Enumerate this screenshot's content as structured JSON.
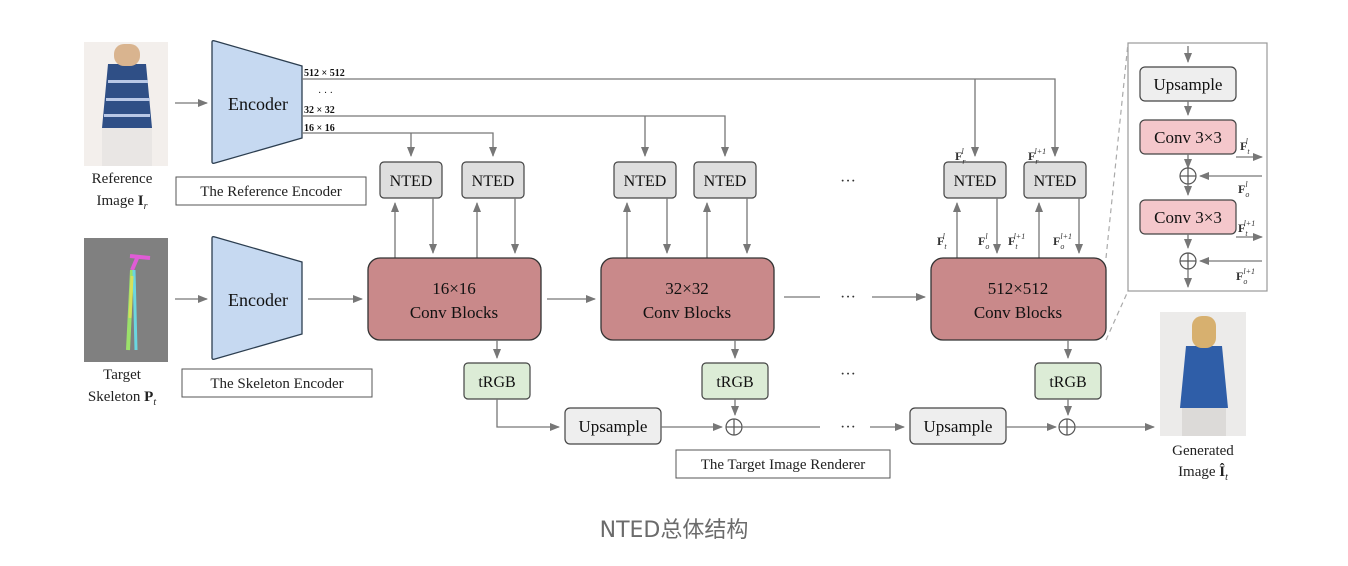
{
  "labels": {
    "encoder": "Encoder",
    "nted": "NTED",
    "trgb": "tRGB",
    "upsample": "Upsample",
    "conv33": "Conv 3×3",
    "dots": "···",
    "conv_line2": "Conv Blocks",
    "res_16": "16×16",
    "res_32": "32×32",
    "res_512": "512×512",
    "feat_512": "512 × 512",
    "feat_32": "32 × 32",
    "feat_16": "16 × 16",
    "feat_dots": "· · ·"
  },
  "captions": {
    "reference_encoder": "The Reference Encoder",
    "skeleton_encoder": "The Skeleton Encoder",
    "renderer": "The Target Image Renderer",
    "ref_line1": "Reference",
    "ref_line2": "Image",
    "tgt_line1": "Target",
    "tgt_line2": "Skeleton",
    "gen_line1": "Generated",
    "gen_line2": "Image",
    "figure": "NTED总体结构"
  },
  "math": {
    "ref_symbol": "I",
    "ref_sub": "r",
    "tgt_symbol": "P",
    "tgt_sub": "t",
    "gen_symbol": "Î",
    "gen_sub": "t",
    "F": "F",
    "sub_t": "t",
    "sub_o": "o",
    "sub_r": "r",
    "sup_l": "l",
    "sup_l1": "l+1"
  },
  "colors": {
    "encoder_fill": "#c6d9f1",
    "encoder_stroke": "#2c3e50",
    "conv_fill": "#c9898a",
    "conv_stroke": "#333333",
    "nted_fill": "#dedede",
    "trgb_fill": "#dcecd6",
    "pink_fill": "#f4c7cb",
    "arrow": "#777777"
  }
}
